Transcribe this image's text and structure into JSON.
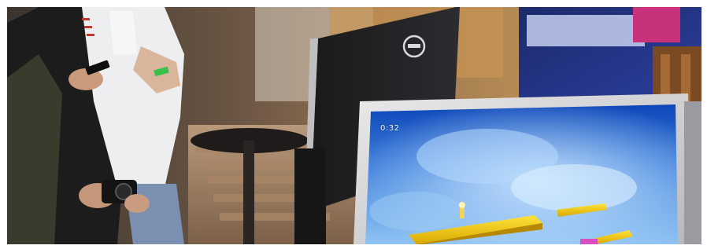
{
  "photo": {
    "scene": "people-playing-game-on-monitor",
    "monitor_brand_icon": "dell-logo-icon"
  },
  "game_screen": {
    "hud_text": "0:32"
  }
}
